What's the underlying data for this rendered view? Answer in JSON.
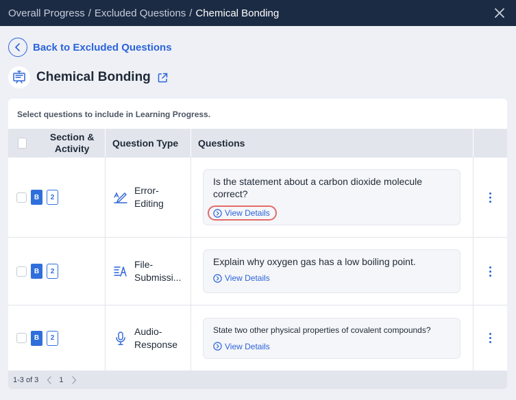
{
  "breadcrumb": {
    "items": [
      "Overall Progress",
      "Excluded Questions"
    ],
    "current": "Chemical Bonding",
    "separator": "/"
  },
  "back_link": {
    "label": "Back to Excluded Questions"
  },
  "header": {
    "title": "Chemical Bonding"
  },
  "instruction": "Select questions to include in Learning Progress.",
  "table": {
    "columns": [
      "Section & Activity",
      "Question Type",
      "Questions"
    ],
    "rows": [
      {
        "section_badge": "B",
        "activity_badge": "2",
        "question_type": "Error-Editing",
        "question_type_icon": "pen-edit-icon",
        "question": "Is the statement about a carbon dioxide molecule correct?",
        "view_details": "View Details"
      },
      {
        "section_badge": "B",
        "activity_badge": "2",
        "question_type": "File-Submissi...",
        "question_type_icon": "file-text-icon",
        "question": "Explain why oxygen gas has a low boiling point.",
        "view_details": "View Details"
      },
      {
        "section_badge": "B",
        "activity_badge": "2",
        "question_type": "Audio-Response",
        "question_type_icon": "microphone-icon",
        "question": "State two other physical properties of covalent compounds?",
        "view_details": "View Details"
      }
    ]
  },
  "pagination": {
    "range": "1-3 of 3",
    "page": "1"
  },
  "colors": {
    "titlebar": "#1c2b44",
    "accent": "#2b63d9",
    "highlight": "#e26a6a"
  }
}
